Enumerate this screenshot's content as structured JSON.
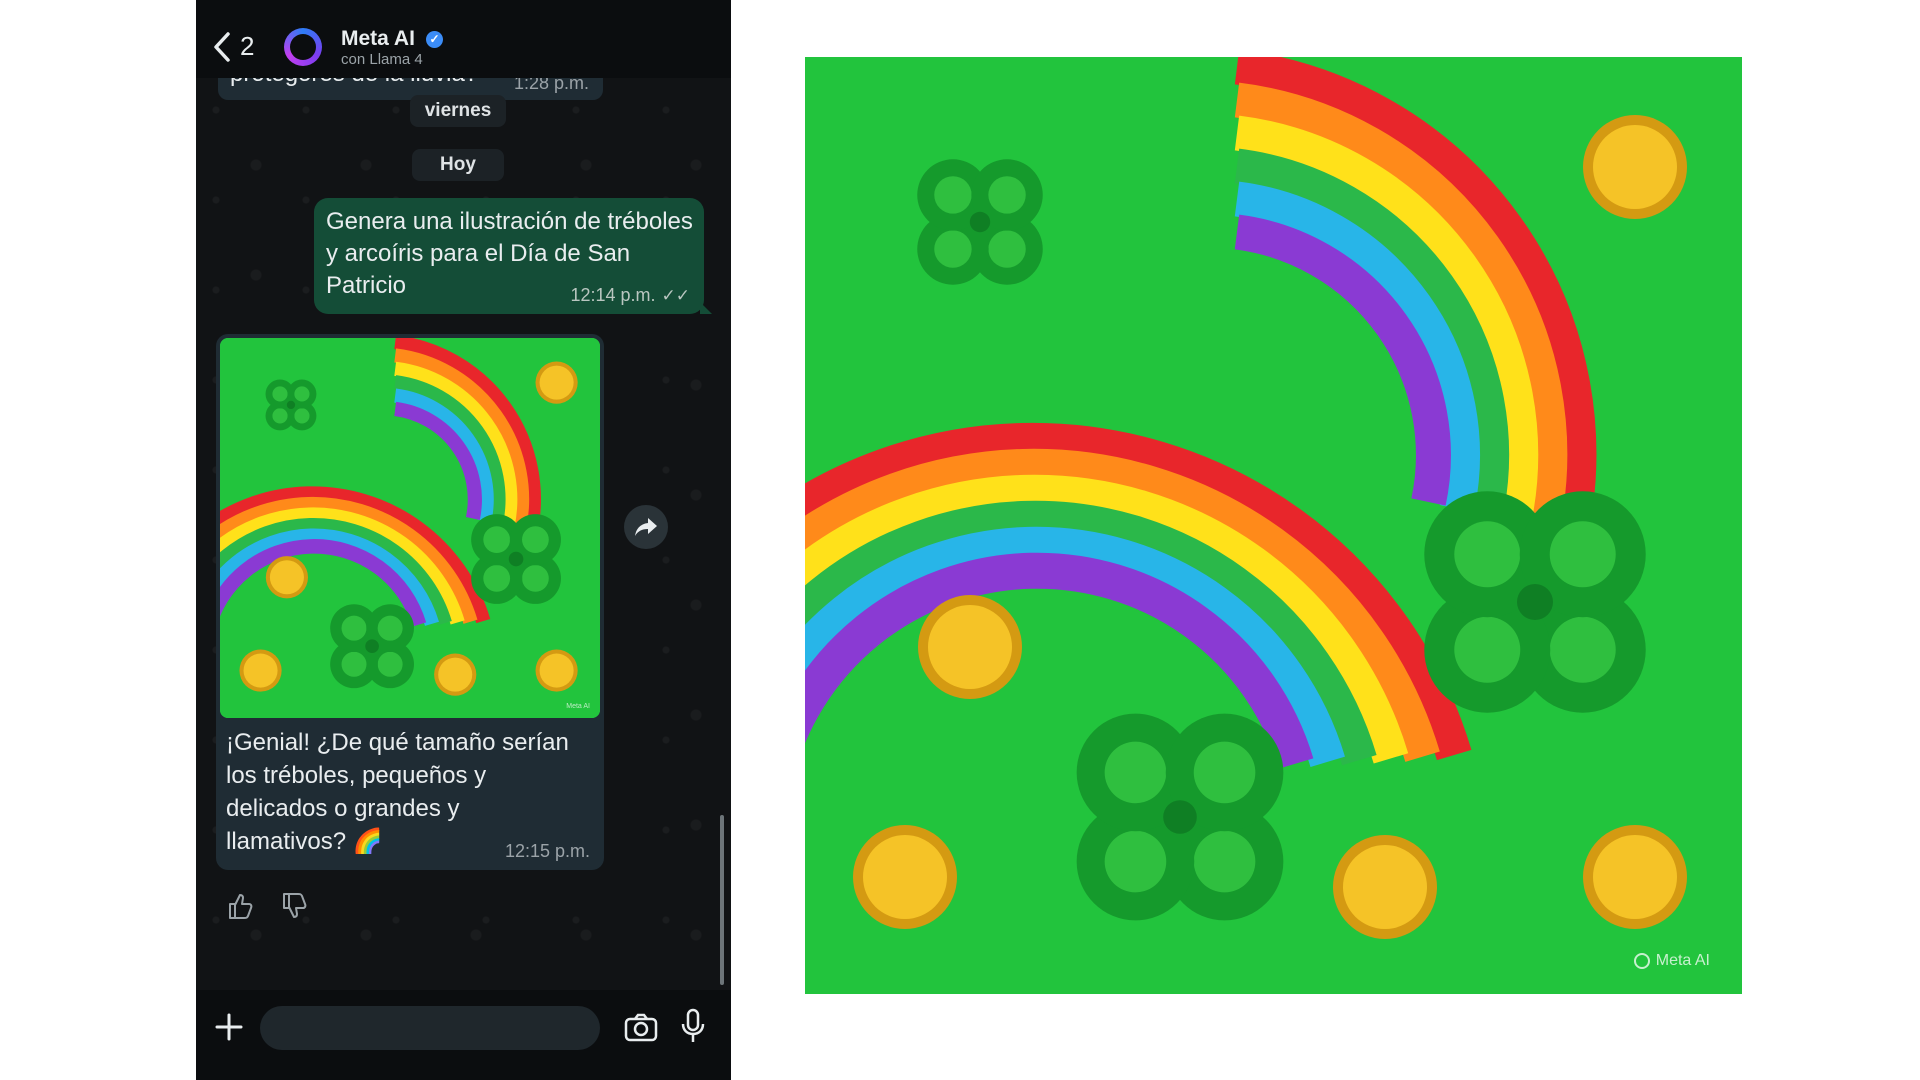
{
  "header": {
    "back_count": "2",
    "contact_name": "Meta AI",
    "contact_subtitle": "con Llama 4"
  },
  "chat": {
    "previous_message": {
      "text": "protegores de la lluvia?",
      "time": "1:28 p.m."
    },
    "date_dividers": [
      "viernes",
      "Hoy"
    ],
    "user_message": {
      "text": "Genera una ilustración de tréboles y arcoíris para el Día de San Patricio",
      "time": "12:14 p.m.",
      "status_icon": "double-check-icon"
    },
    "ai_message": {
      "image_alt": "St. Patrick's Day illustration with shamrocks, rainbows and gold coins",
      "text": "¡Genial! ¿De qué tamaño serían los tréboles, pequeños y delicados o grandes y llamativos? 🌈",
      "time": "12:15 p.m.",
      "watermark": "Meta AI"
    }
  },
  "composer": {
    "placeholder": "",
    "icons": [
      "plus-icon",
      "camera-icon",
      "mic-icon"
    ]
  },
  "image_preview": {
    "watermark": "Meta AI"
  },
  "colors": {
    "bg_green": "#22c43d",
    "outgoing_bubble": "#144d37",
    "incoming_bubble": "#1f2c34",
    "rainbow": [
      "#e8262b",
      "#ff8a1a",
      "#ffe11a",
      "#2bb84a",
      "#28b5e8",
      "#8a3ad3"
    ]
  }
}
